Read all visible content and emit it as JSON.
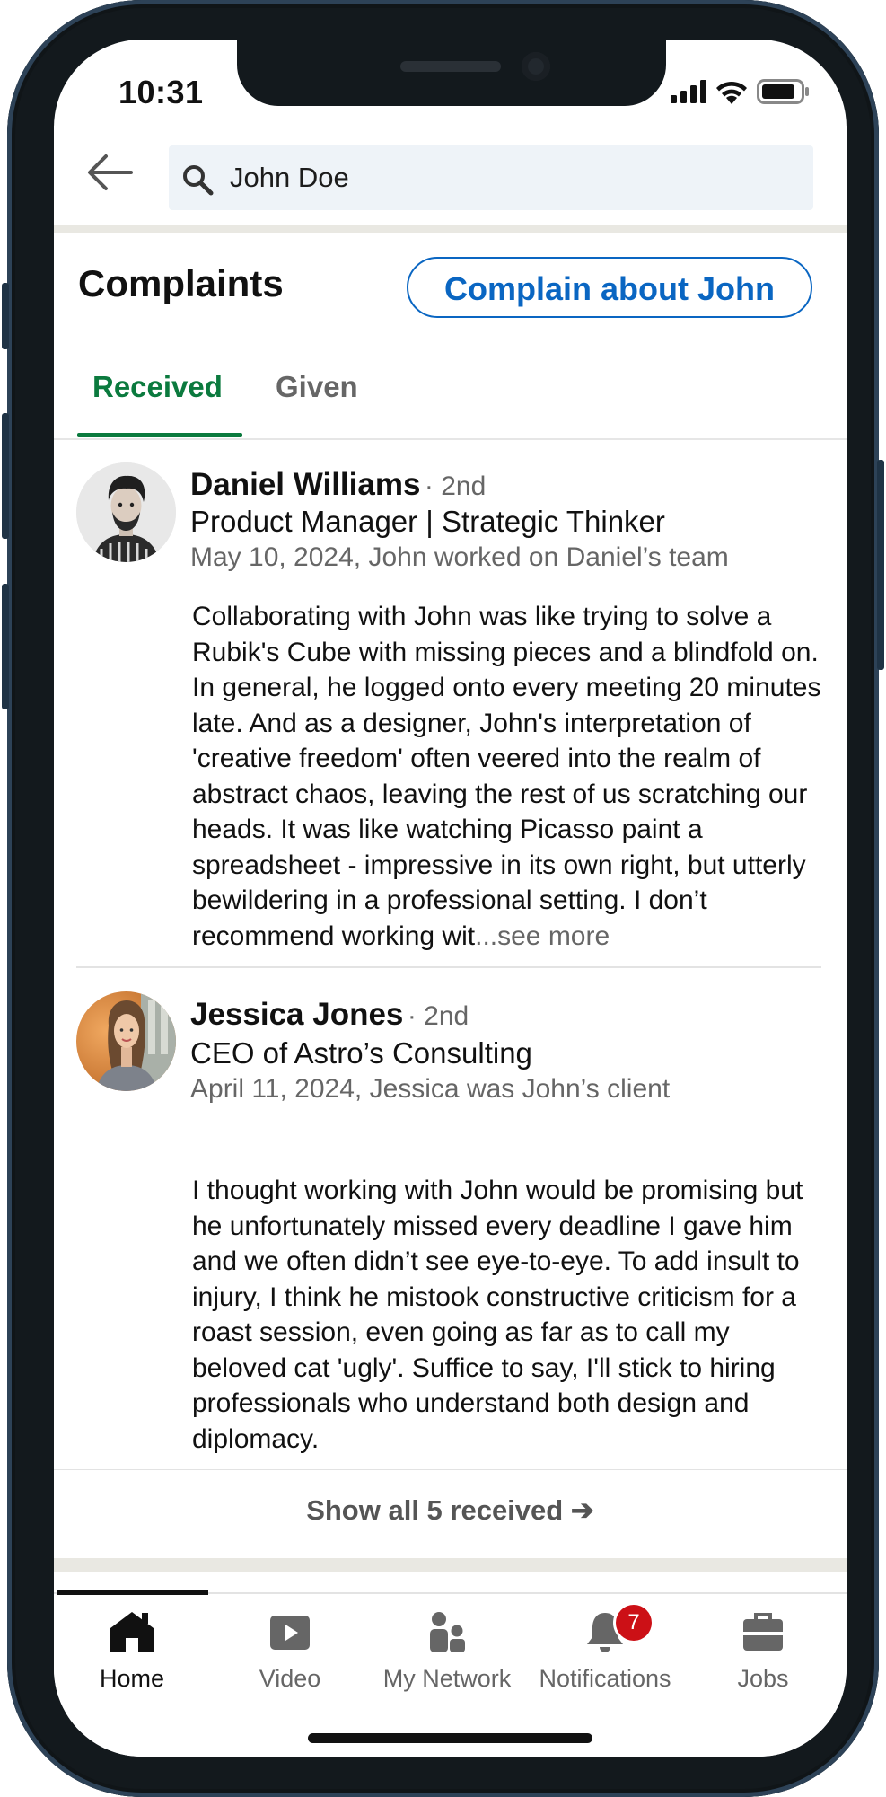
{
  "status_bar": {
    "time": "10:31"
  },
  "search": {
    "value": "John Doe"
  },
  "header": {
    "title": "Complaints",
    "complain_button": "Complain about John"
  },
  "tabs": [
    {
      "label": "Received",
      "active": true
    },
    {
      "label": "Given",
      "active": false
    }
  ],
  "complaints": [
    {
      "name": "Daniel Williams",
      "degree": "· 2nd",
      "headline": "Product Manager | Strategic Thinker",
      "meta": "May 10, 2024, John worked on Daniel’s team",
      "text": "Collaborating with John was like trying to solve a Rubik's Cube with missing pieces and a blindfold on. In general, he logged onto every meeting 20 minutes late. And as a designer, John's interpretation of 'creative freedom' often veered into the realm of abstract chaos, leaving the rest of us scratching our heads. It was like watching Picasso paint a spreadsheet - impressive in its own right, but utterly bewildering in a professional setting. I don’t recommend working wit",
      "see_more": "...see more"
    },
    {
      "name": "Jessica Jones",
      "degree": "· 2nd",
      "headline": "CEO of Astro’s Consulting",
      "meta": "April 11, 2024, Jessica was John’s client",
      "text": "I thought working with John would be promising but he unfortunately missed every deadline I gave him and we often didn’t see eye-to-eye. To add insult to injury, I think he mistook constructive criticism for a roast session, even going as far as to call my beloved cat 'ugly'. Suffice to say, I'll stick to hiring professionals who understand both design and diplomacy."
    }
  ],
  "show_all": {
    "label": "Show all 5 received ➔"
  },
  "bottom_nav": [
    {
      "label": "Home",
      "icon": "home-icon",
      "active": true
    },
    {
      "label": "Video",
      "icon": "video-icon"
    },
    {
      "label": "My Network",
      "icon": "network-icon"
    },
    {
      "label": "Notifications",
      "icon": "bell-icon",
      "badge": "7"
    },
    {
      "label": "Jobs",
      "icon": "briefcase-icon"
    }
  ],
  "colors": {
    "accent_green": "#0b7a3e",
    "link_blue": "#0a66c2",
    "badge_red": "#cc1016",
    "frame": "#13191d"
  }
}
